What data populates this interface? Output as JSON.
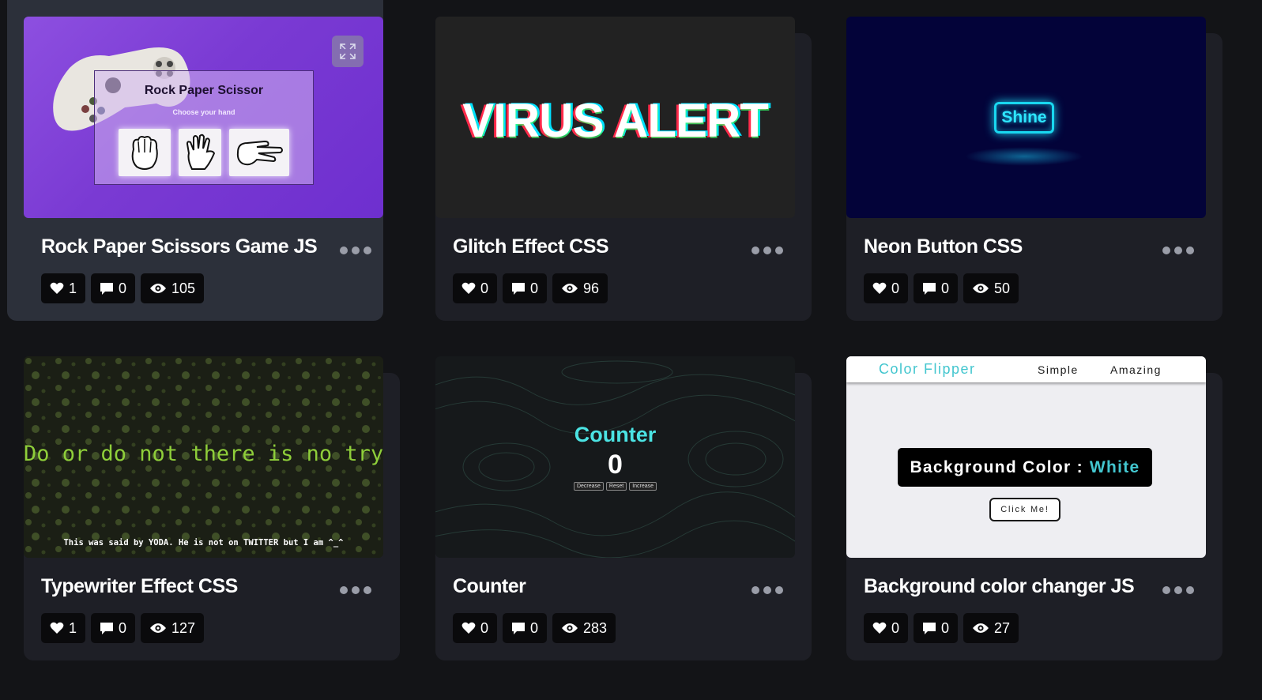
{
  "cards": [
    {
      "title": "Rock Paper Scissors Game JS",
      "likes": "1",
      "comments": "0",
      "views": "105",
      "preview": {
        "heading": "Rock Paper Scissor",
        "subheading": "Choose your hand",
        "icon": "expand-icon"
      }
    },
    {
      "title": "Glitch Effect CSS",
      "likes": "0",
      "comments": "0",
      "views": "96",
      "preview": {
        "text": "VIRUS ALERT"
      }
    },
    {
      "title": "Neon Button CSS",
      "likes": "0",
      "comments": "0",
      "views": "50",
      "preview": {
        "button": "Shine"
      }
    },
    {
      "title": "Typewriter Effect CSS",
      "likes": "1",
      "comments": "0",
      "views": "127",
      "preview": {
        "line": "Do or do not there is no try",
        "quote": "This was said by YODA. He is not on TWITTER but I am ^_^"
      }
    },
    {
      "title": "Counter",
      "likes": "0",
      "comments": "0",
      "views": "283",
      "preview": {
        "heading": "Counter",
        "value": "0",
        "decrease": "Decrease",
        "reset": "Reset",
        "increase": "Increase"
      }
    },
    {
      "title": "Background color changer JS",
      "likes": "0",
      "comments": "0",
      "views": "27",
      "preview": {
        "brand": "Color Flipper",
        "link1": "Simple",
        "link2": "Amazing",
        "label": "Background Color :",
        "color": "White",
        "button": "Click Me!"
      }
    }
  ],
  "icons": {
    "like": "heart-icon",
    "comment": "comment-icon",
    "view": "eye-icon",
    "more": "more-dots-icon"
  },
  "colors": {
    "page_bg": "#131417",
    "card_bg": "#1e1f26",
    "card_hover_bg": "#2c303a",
    "stat_bg": "#0a0a0c"
  }
}
